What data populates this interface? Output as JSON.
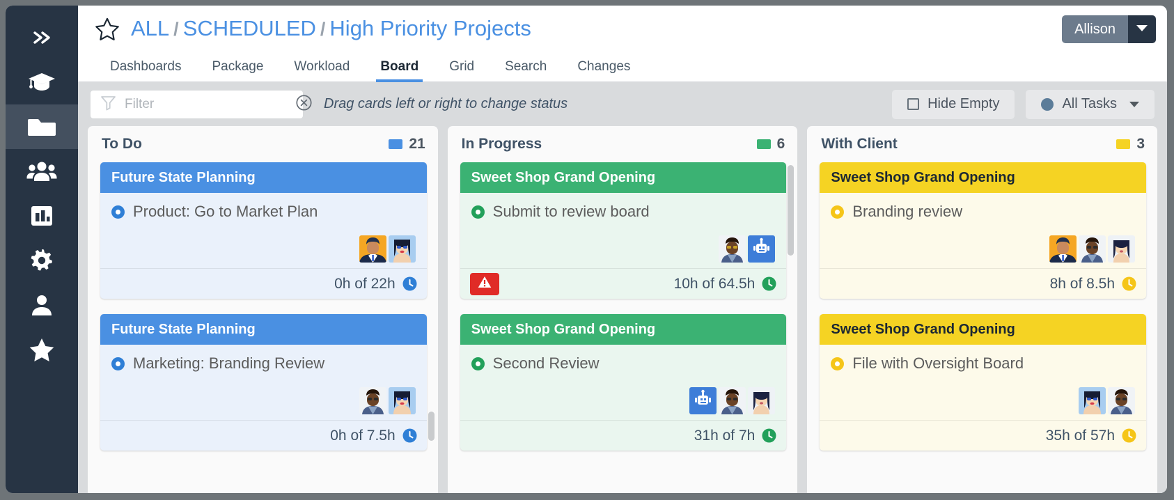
{
  "sidebar": {
    "items": [
      {
        "name": "collapse-expand",
        "icon": "chevrons-right-icon",
        "active": false
      },
      {
        "name": "learning",
        "icon": "graduation-cap-icon",
        "active": false
      },
      {
        "name": "projects",
        "icon": "folder-icon",
        "active": true
      },
      {
        "name": "teams",
        "icon": "users-icon",
        "active": false
      },
      {
        "name": "reports",
        "icon": "chart-bar-icon",
        "active": false
      },
      {
        "name": "settings",
        "icon": "gear-icon",
        "active": false
      },
      {
        "name": "profile",
        "icon": "user-icon",
        "active": false
      },
      {
        "name": "favorites",
        "icon": "star-icon",
        "active": false
      }
    ]
  },
  "header": {
    "favorite_icon": "star-outline-icon",
    "breadcrumb": [
      "ALL",
      "SCHEDULED",
      "High Priority Projects"
    ],
    "separator": "/",
    "user": {
      "name": "Allison",
      "caret_icon": "caret-down-icon"
    }
  },
  "tabs": [
    {
      "label": "Dashboards",
      "active": false
    },
    {
      "label": "Package",
      "active": false
    },
    {
      "label": "Workload",
      "active": false
    },
    {
      "label": "Board",
      "active": true
    },
    {
      "label": "Grid",
      "active": false
    },
    {
      "label": "Search",
      "active": false
    },
    {
      "label": "Changes",
      "active": false
    }
  ],
  "toolbar": {
    "filter": {
      "value": "",
      "placeholder": "Filter",
      "icon": "funnel-icon",
      "clear_icon": "clear-circle-icon"
    },
    "hint": "Drag cards left or right to change status",
    "hide_empty": {
      "label": "Hide Empty",
      "checked": false,
      "icon": "checkbox-icon"
    },
    "task_filter": {
      "label": "All Tasks",
      "icon": "status-dot-icon",
      "caret_icon": "caret-down-icon"
    }
  },
  "board": {
    "columns": [
      {
        "title": "To Do",
        "count": "21",
        "color": "#4a90e2",
        "body_bg": "#eaf1fb",
        "cards": [
          {
            "project": "Future State Planning",
            "task": "Product: Go to Market Plan",
            "time": "0h of 22h",
            "warning": false,
            "avatars": [
              "man-orange-bg",
              "woman-sunglasses-blue-bg"
            ]
          },
          {
            "project": "Future State Planning",
            "task": "Marketing: Branding Review",
            "time": "0h of 7.5h",
            "warning": false,
            "avatars": [
              "man-glasses-light-bg",
              "woman-sunglasses-blue-bg"
            ]
          }
        ]
      },
      {
        "title": "In Progress",
        "count": "6",
        "color": "#3bb273",
        "body_bg": "#eaf6ef",
        "cards": [
          {
            "project": "Sweet Shop Grand Opening",
            "task": "Submit to review board",
            "time": "10h of 64.5h",
            "warning": true,
            "warning_icon": "alert-triangle-icon",
            "avatars": [
              "man-glasses-light-bg",
              "robot-blue-bg"
            ]
          },
          {
            "project": "Sweet Shop Grand Opening",
            "task": "Second Review",
            "time": "31h of 7h",
            "warning": false,
            "avatars": [
              "robot-blue-bg",
              "man-glasses-light-bg",
              "woman-dark-hair"
            ]
          }
        ]
      },
      {
        "title": "With Client",
        "count": "3",
        "color": "#f5d323",
        "body_bg": "#fdfaea",
        "cards": [
          {
            "project": "Sweet Shop Grand Opening",
            "task": "Branding review",
            "time": "8h of 8.5h",
            "warning": false,
            "avatars": [
              "man-orange-bg",
              "man-glasses-light-bg",
              "woman-dark-hair"
            ]
          },
          {
            "project": "Sweet Shop Grand Opening",
            "task": "File with Oversight Board",
            "time": "35h of 57h",
            "warning": false,
            "avatars": [
              "woman-sunglasses-blue-bg",
              "man-glasses-light-bg"
            ]
          }
        ]
      }
    ]
  }
}
